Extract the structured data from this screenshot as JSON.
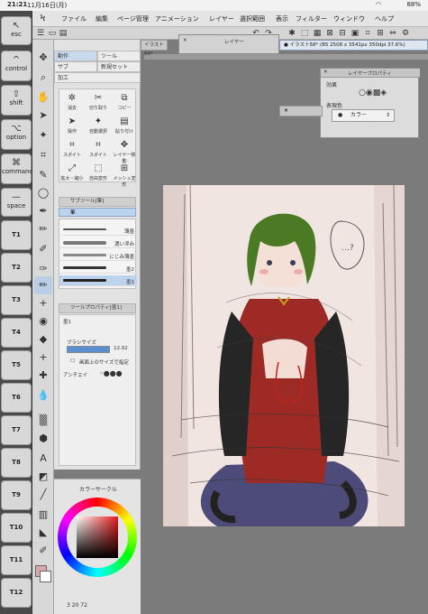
{
  "status": {
    "time": "21:21",
    "date": "11月16日(月)",
    "wifi": "wifi",
    "battery": "88%"
  },
  "edge_keys": [
    {
      "symbol": "↖",
      "label": "esc"
    },
    {
      "symbol": "^",
      "label": "control"
    },
    {
      "symbol": "⇧",
      "label": "shift"
    },
    {
      "symbol": "⌥",
      "label": "option"
    },
    {
      "symbol": "⌘",
      "label": "command"
    },
    {
      "symbol": "—",
      "label": "space"
    }
  ],
  "fkeys": [
    "T1",
    "T2",
    "T3",
    "T4",
    "T5",
    "T6",
    "T7",
    "T8",
    "T9",
    "T10",
    "T11",
    "T12"
  ],
  "menu": [
    "ファイル",
    "編集",
    "ページ管理",
    "アニメーション",
    "レイヤー",
    "選択範囲",
    "表示",
    "フィルター",
    "ウィンドウ",
    "ヘルプ"
  ],
  "subtool": {
    "tabs": [
      "動作",
      "ツール",
      "サブ",
      "新規セット",
      "加工"
    ],
    "grid": [
      "消去",
      "切り取り",
      "コピー",
      "操作",
      "自動選択",
      "貼り付け",
      "スポイト",
      "スポイト",
      "レイヤー移動",
      "拡大・縮小",
      "自由変形",
      "メッシュ変形"
    ],
    "header": "サブツール[筆]",
    "selected_group": "筆"
  },
  "brushes": [
    "薄墨",
    "濃い滲み",
    "にじみ薄墨",
    "墨2",
    "墨1"
  ],
  "tool_property": {
    "header": "ツールプロパティ[墨1]",
    "name": "墨1",
    "brush_size_label": "ブラシサイズ",
    "brush_size": "12.92",
    "screen_size_label": "画面上のサイズで指定",
    "antialias_label": "アンチエイ"
  },
  "color": {
    "title": "カラーサークル",
    "footer": "3 20 72"
  },
  "canvas": {
    "file_tab": "イラスト64*",
    "doc_tab": "● イラスト58* (B5 2508 x 3541px 350dpi 37.6%)",
    "layer_window": "レイヤー",
    "speech": "…?"
  },
  "layer_property": {
    "title": "レイヤープロパティ",
    "effect_label": "効果",
    "display_color_label": "表現色",
    "display_color_value": "カラー"
  },
  "colors": {
    "paper": "#f1e5e2",
    "hair": "#4a7a24",
    "dress": "#9e2a26",
    "pants": "#3a3a6e",
    "accent": "#bcd3ee"
  }
}
